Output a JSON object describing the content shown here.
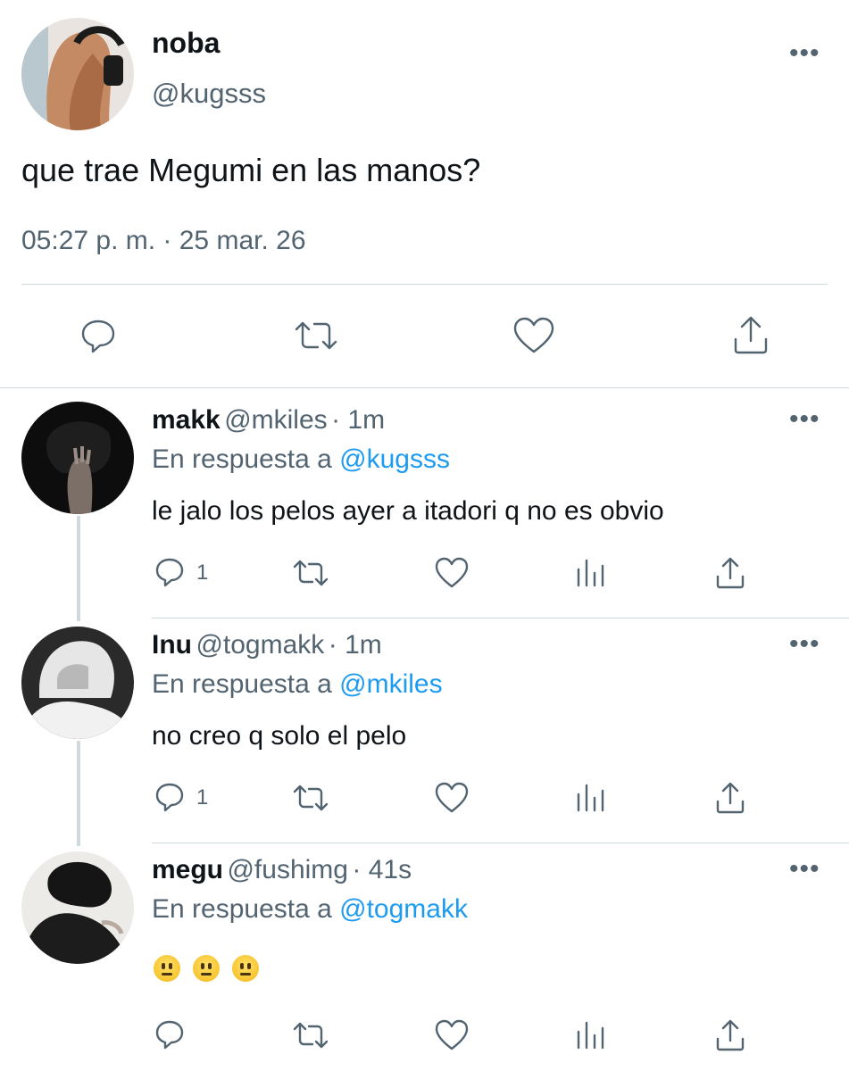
{
  "main_tweet": {
    "display_name": "noba",
    "handle": "@kugsss",
    "text": "que trae Megumi en las manos?",
    "timestamp": "05:27 p. m. · 25 mar. 26",
    "actions": [
      "reply-icon",
      "retweet-icon",
      "like-icon",
      "share-icon"
    ]
  },
  "replies": [
    {
      "display_name": "makk",
      "handle": "@mkiles",
      "time": "· 1m",
      "reply_prefix": "En respuesta a",
      "reply_to": "@kugsss",
      "text": "le jalo los pelos ayer a itadori q no es obvio",
      "reply_count": "1"
    },
    {
      "display_name": "Inu",
      "handle": "@togmakk",
      "time": "· 1m",
      "reply_prefix": "En respuesta a",
      "reply_to": "@mkiles",
      "text": "no creo q solo el pelo",
      "reply_count": "1"
    },
    {
      "display_name": "megu",
      "handle": "@fushimg",
      "time": "· 41s",
      "reply_prefix": "En respuesta a",
      "reply_to": "@togmakk",
      "emoji_text": "😐😐😐",
      "reply_count": ""
    }
  ],
  "more_label": "•••",
  "colors": {
    "accent": "#1d9bf0",
    "muted": "#536471",
    "text": "#0f1419",
    "divider": "#cfd9de"
  }
}
